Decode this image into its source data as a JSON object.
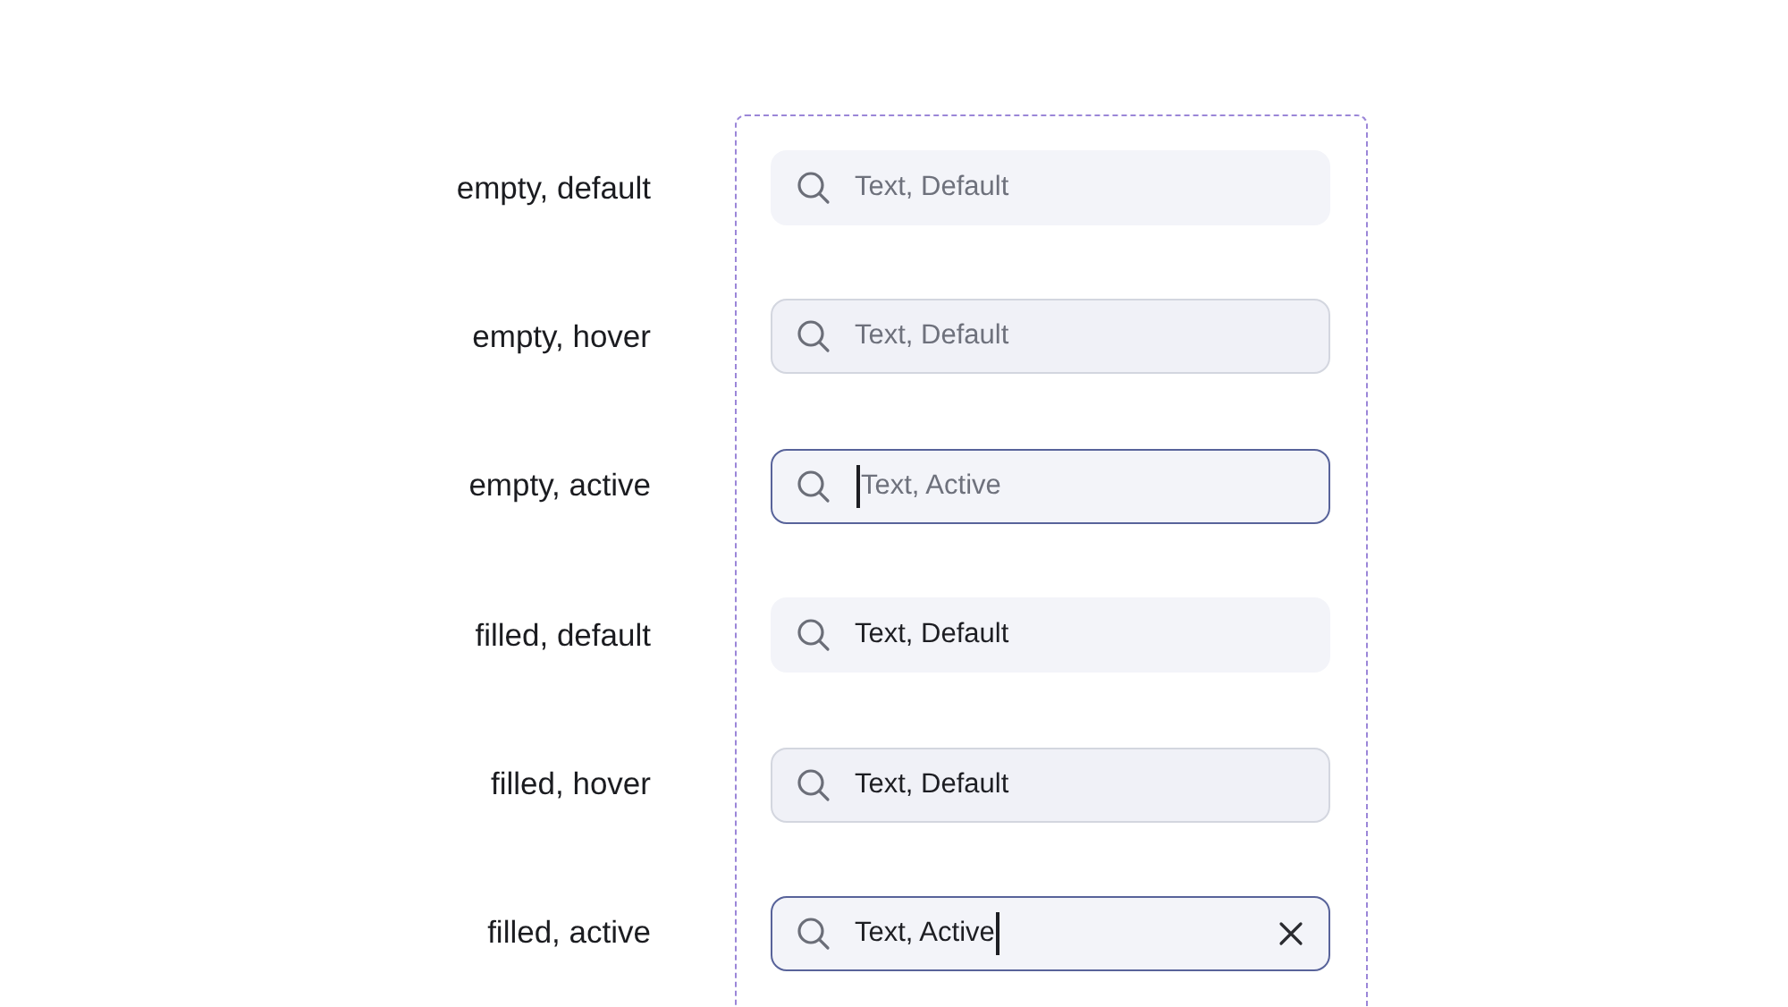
{
  "rows": [
    {
      "label": "empty, default",
      "field": {
        "hovered": false,
        "focused": false,
        "placeholder": "Text, Default",
        "clearable": false
      }
    },
    {
      "label": "empty, hover",
      "field": {
        "hovered": true,
        "focused": false,
        "placeholder": "Text, Default",
        "clearable": false
      }
    },
    {
      "label": "empty, active",
      "field": {
        "hovered": false,
        "focused": true,
        "placeholder": "Text, Active",
        "clearable": false
      }
    },
    {
      "label": "filled, default",
      "field": {
        "hovered": false,
        "focused": false,
        "value": "Text, Default",
        "clearable": false
      }
    },
    {
      "label": "filled, hover",
      "field": {
        "hovered": true,
        "focused": false,
        "value": "Text, Default",
        "clearable": false
      }
    },
    {
      "label": "filled, active",
      "field": {
        "hovered": false,
        "focused": true,
        "value": "Text, Active",
        "clearable": true
      }
    }
  ]
}
